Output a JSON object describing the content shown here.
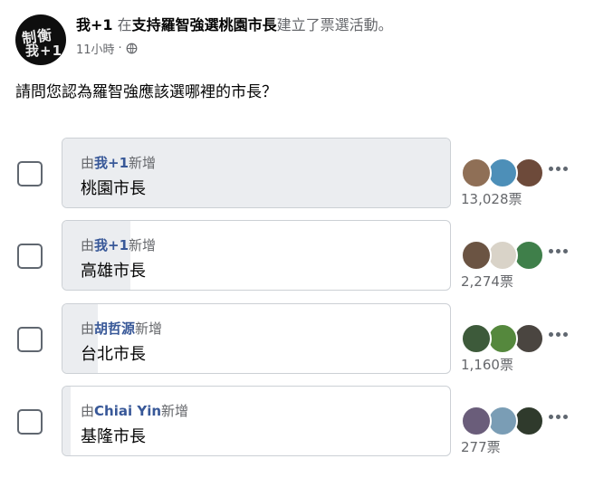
{
  "post": {
    "author": "我+1",
    "action_in": "在",
    "group": "支持羅智強選桃園市長",
    "action_text": "建立了票選活動。",
    "time": "11小時",
    "separator": "·",
    "privacy_icon": "globe-icon",
    "avatar_glyph_top": "制衡",
    "avatar_glyph_bottom": "我+1",
    "question": "請問您認為羅智強應該選哪裡的市長？"
  },
  "poll": {
    "added_prefix": "由",
    "added_suffix": "新增",
    "options": [
      {
        "added_by": "我+1",
        "label": "桃園市長",
        "votes": "13,028票",
        "fill_ratio": 1.0,
        "voters": [
          "#8f6f56",
          "#4d8fb8",
          "#6d4a3a"
        ]
      },
      {
        "added_by": "我+1",
        "label": "高雄市長",
        "votes": "2,274票",
        "fill_ratio": 0.175,
        "voters": [
          "#6b5443",
          "#d9d3c8",
          "#3f7f4a"
        ]
      },
      {
        "added_by": "胡哲源",
        "label": "台北市長",
        "votes": "1,160票",
        "fill_ratio": 0.09,
        "voters": [
          "#3d5a3a",
          "#55883d",
          "#4a4540"
        ]
      },
      {
        "added_by": "Chiai Yin",
        "label": "基隆市長",
        "votes": "277票",
        "fill_ratio": 0.022,
        "voters": [
          "#6a5d7a",
          "#7a9db5",
          "#2f3a2c"
        ]
      }
    ]
  },
  "colors": {
    "link": "#385898",
    "muted": "#65676b",
    "border": "#ccd0d5",
    "fill": "#ebedf0"
  }
}
